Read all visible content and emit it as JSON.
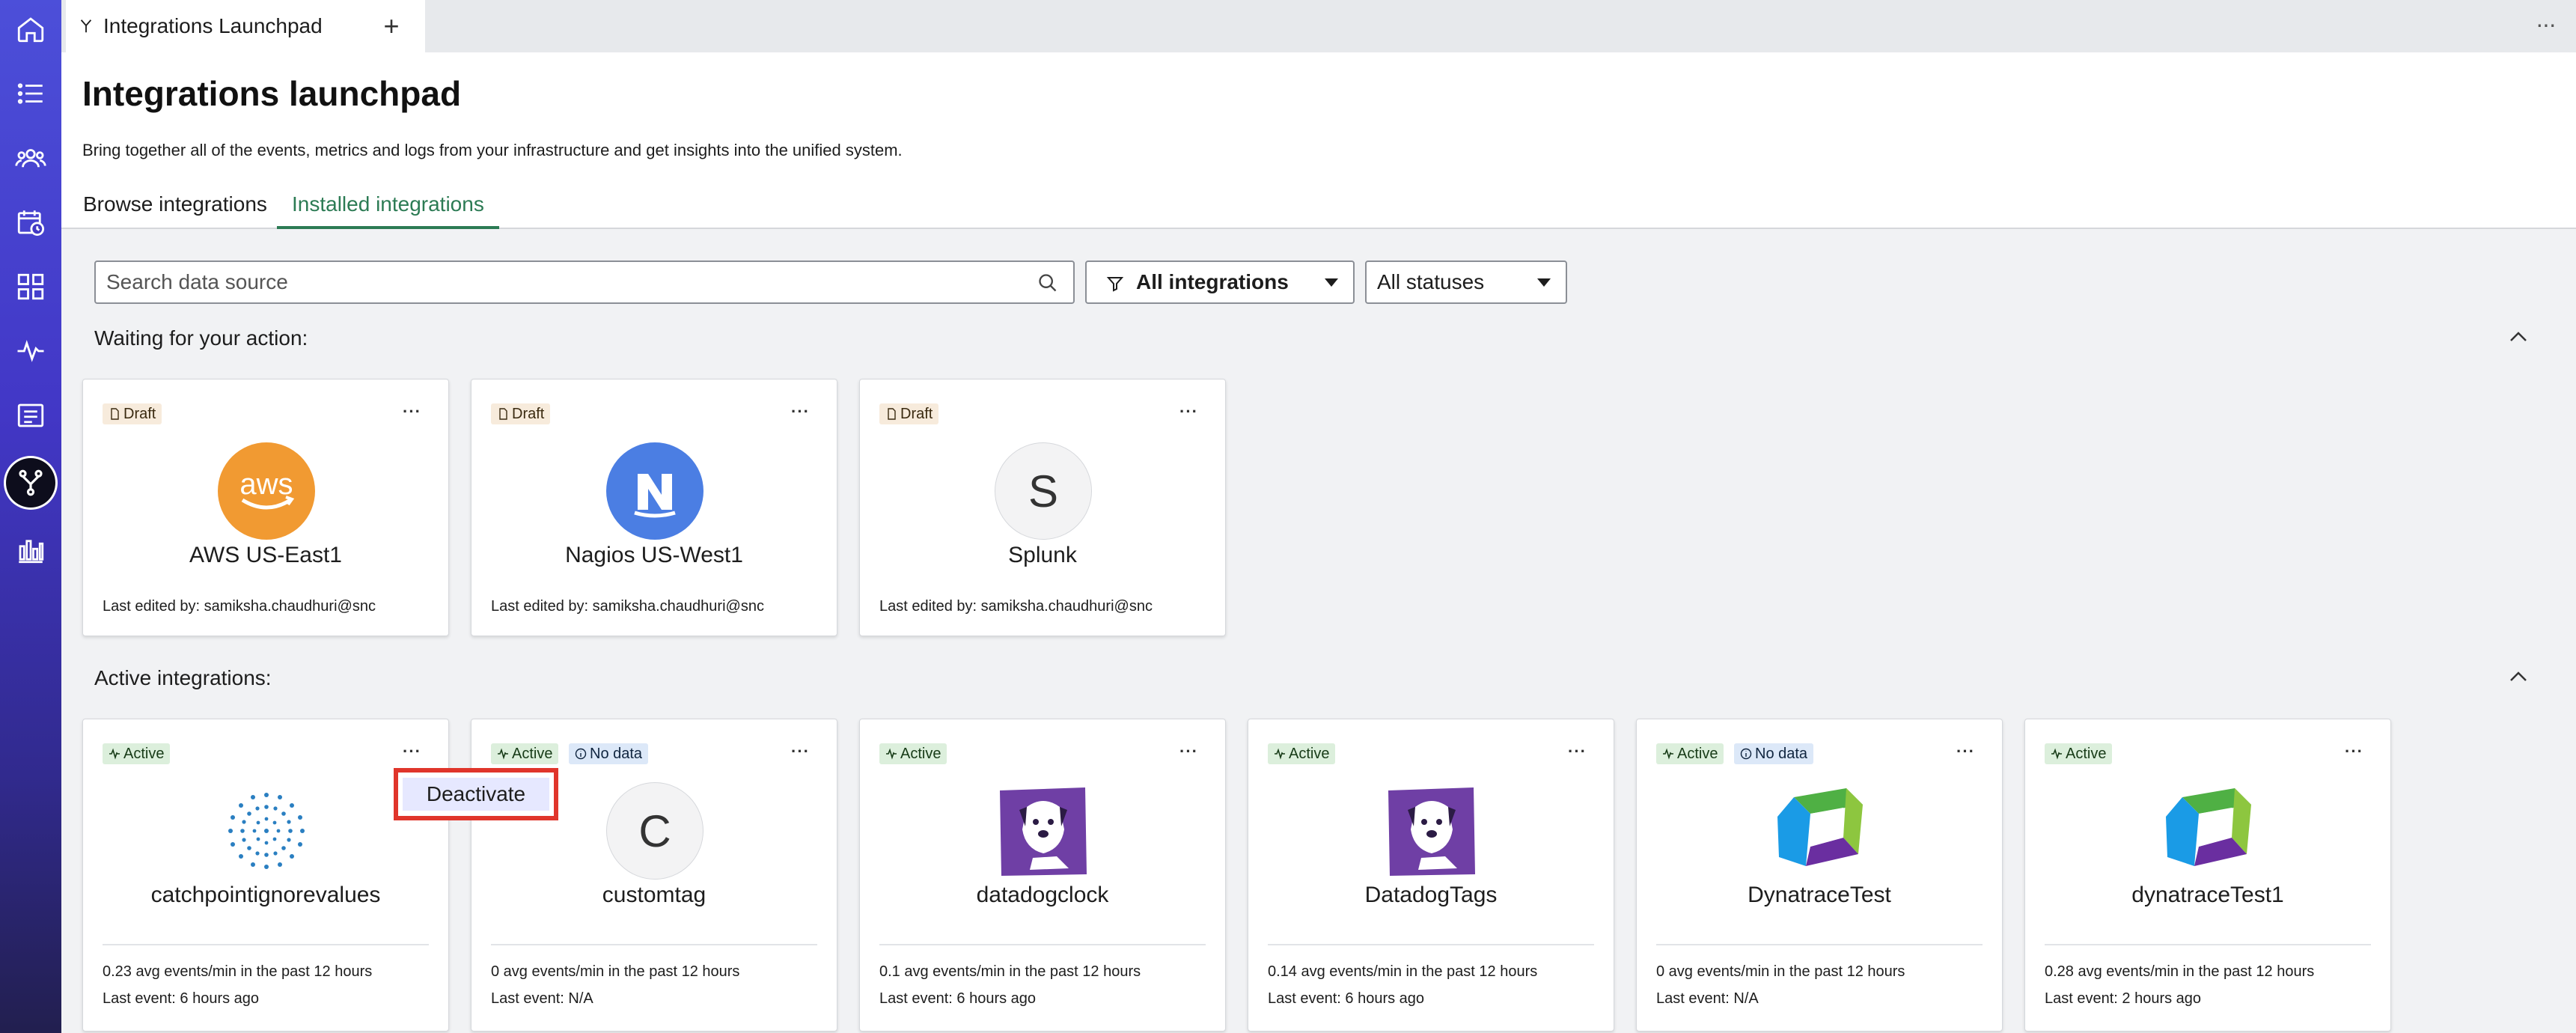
{
  "tabstrip": {
    "tab_label": "Integrations Launchpad",
    "new_tab": "+",
    "overflow": "···"
  },
  "header": {
    "title": "Integrations launchpad",
    "subtitle": "Bring together all of the events, metrics and logs from your infrastructure and get insights into the unified system."
  },
  "tabs": {
    "browse": "Browse integrations",
    "installed": "Installed integrations"
  },
  "filters": {
    "search_placeholder": "Search data source",
    "integrations": "All integrations",
    "statuses": "All statuses"
  },
  "sections": {
    "waiting": "Waiting for your action:",
    "active": "Active integrations:"
  },
  "waiting_cards": [
    {
      "badge": "Draft",
      "name": "AWS US-East1",
      "meta": "Last edited by: samiksha.chaudhuri@snc",
      "logo": "aws-logo"
    },
    {
      "badge": "Draft",
      "name": "Nagios US-West1",
      "meta": "Last edited by: samiksha.chaudhuri@snc",
      "logo": "nagios-logo"
    },
    {
      "badge": "Draft",
      "name": "Splunk",
      "meta": "Last edited by: samiksha.chaudhuri@snc",
      "logo": "S"
    }
  ],
  "active_cards": [
    {
      "badge": "Active",
      "nodata": "",
      "name": "catchpointignorevalues",
      "stat": "0.23 avg events/min in the past 12 hours",
      "last": "Last event: 6 hours ago",
      "logo": "catchpoint-logo"
    },
    {
      "badge": "Active",
      "nodata": "No data",
      "name": "customtag",
      "stat": "0 avg events/min in the past 12 hours",
      "last": "Last event: N/A",
      "logo": "C"
    },
    {
      "badge": "Active",
      "nodata": "",
      "name": "datadogclock",
      "stat": "0.1 avg events/min in the past 12 hours",
      "last": "Last event: 6 hours ago",
      "logo": "datadog-logo"
    },
    {
      "badge": "Active",
      "nodata": "",
      "name": "DatadogTags",
      "stat": "0.14 avg events/min in the past 12 hours",
      "last": "Last event: 6 hours ago",
      "logo": "datadog-logo"
    },
    {
      "badge": "Active",
      "nodata": "No data",
      "name": "DynatraceTest",
      "stat": "0 avg events/min in the past 12 hours",
      "last": "Last event: N/A",
      "logo": "dynatrace-logo"
    },
    {
      "badge": "Active",
      "nodata": "",
      "name": "dynatraceTest1",
      "stat": "0.28 avg events/min in the past 12 hours",
      "last": "Last event: 2 hours ago",
      "logo": "dynatrace-logo"
    }
  ],
  "card_menu": "···",
  "popup": {
    "label": "Deactivate"
  },
  "colors": {
    "accent": "#2c7b54",
    "rail_top": "#4c4fd9",
    "rail_bottom": "#221f4f",
    "highlight": "#e0352b"
  }
}
